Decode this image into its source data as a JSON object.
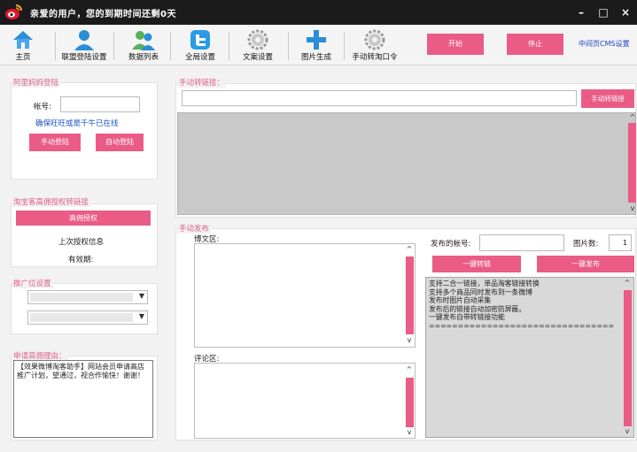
{
  "window": {
    "title": "亲爱的用户，您的到期时间还剩0天",
    "minimize": "–",
    "maximize": "□",
    "close": "×"
  },
  "toolbar": {
    "items": [
      {
        "label": "主页",
        "icon": "home-icon"
      },
      {
        "label": "联盟登陆设置",
        "icon": "user-icon"
      },
      {
        "label": "数据列表",
        "icon": "users-icon"
      },
      {
        "label": "全局设置",
        "icon": "blue-bird-icon"
      },
      {
        "label": "文案设置",
        "icon": "gear-icon"
      },
      {
        "label": "图片生成",
        "icon": "plus-icon"
      },
      {
        "label": "手动转淘口令",
        "icon": "gear-icon"
      }
    ],
    "start_label": "开始",
    "stop_label": "停止",
    "cms_link": "中间页CMS设置"
  },
  "login": {
    "legend": "阿里妈妈登陆",
    "account_label": "帐号:",
    "account_value": "",
    "hint": "确保旺旺或是千牛已在线",
    "manual_login": "手动登陆",
    "auto_login": "自动登陆"
  },
  "auth": {
    "legend": "淘宝客高佣授权转链接",
    "auth_button": "高佣授权",
    "last_auth": "上次授权信息",
    "validity": "有效期:"
  },
  "promo": {
    "legend": "推广位设置",
    "select1_value": "",
    "select2_value": ""
  },
  "apply": {
    "legend": "申请高佣理由：",
    "text": "【效果微博淘客助手】网站会员申请高店推广计划，望通过，视合作愉快！谢谢！"
  },
  "convert": {
    "legend": "手动转链接：",
    "input_value": "",
    "convert_button": "手动转链接"
  },
  "publish": {
    "legend": "手动发布",
    "weibo_label": "博文区:",
    "comment_label": "评论区:",
    "account_label": "发布的帐号:",
    "account_value": "",
    "pic_count_label": "图片数:",
    "pic_count_value": "1",
    "convert_all": "一键转链",
    "publish_all": "一键发布",
    "info_text": "支持二合一链接，单品淘客链接转换\n支持多个商品同时发布到一条微博\n发布时图片自动采集\n发布后的链接自动加密防屏蔽。\n一键发布自带转链接功能\n================================"
  },
  "colors": {
    "accent": "#ea5b86",
    "legend": "#e25e8e",
    "titlebar": "#1b1b1b"
  }
}
